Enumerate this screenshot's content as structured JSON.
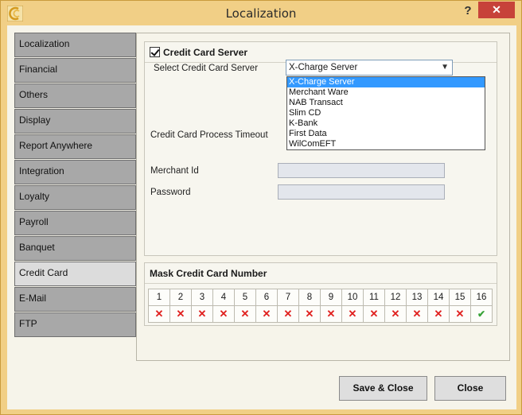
{
  "window": {
    "title": "Localization",
    "help_glyph": "?",
    "close_glyph": "✕"
  },
  "sidebar": {
    "items": [
      {
        "label": "Localization"
      },
      {
        "label": "Financial"
      },
      {
        "label": "Others"
      },
      {
        "label": "Display"
      },
      {
        "label": "Report Anywhere"
      },
      {
        "label": "Integration"
      },
      {
        "label": "Loyalty"
      },
      {
        "label": "Payroll"
      },
      {
        "label": "Banquet"
      },
      {
        "label": "Credit Card",
        "active": true
      },
      {
        "label": "E-Mail"
      },
      {
        "label": "FTP"
      }
    ]
  },
  "credit_card_server": {
    "header": "Credit Card Server",
    "enabled": true,
    "select_label": "Select Credit Card Server",
    "selected_value": "X-Charge Server",
    "options": [
      "X-Charge Server",
      "Merchant Ware",
      "NAB Transact",
      "Slim CD",
      "K-Bank",
      "First Data",
      "WilComEFT"
    ],
    "timeout_label": "Credit Card Process Timeout",
    "merchant_id_label": "Merchant Id",
    "merchant_id_value": "",
    "password_label": "Password",
    "password_value": ""
  },
  "mask": {
    "header": "Mask Credit Card Number",
    "digits": [
      "1",
      "2",
      "3",
      "4",
      "5",
      "6",
      "7",
      "8",
      "9",
      "10",
      "11",
      "12",
      "13",
      "14",
      "15",
      "16"
    ],
    "states": [
      "x",
      "x",
      "x",
      "x",
      "x",
      "x",
      "x",
      "x",
      "x",
      "x",
      "x",
      "x",
      "x",
      "x",
      "x",
      "check"
    ]
  },
  "footer": {
    "save_close": "Save & Close",
    "close": "Close"
  },
  "colors": {
    "accent": "#3399ff",
    "mask_x": "#e0201e",
    "mask_check": "#38a338",
    "title_bar": "#f1cf86"
  }
}
